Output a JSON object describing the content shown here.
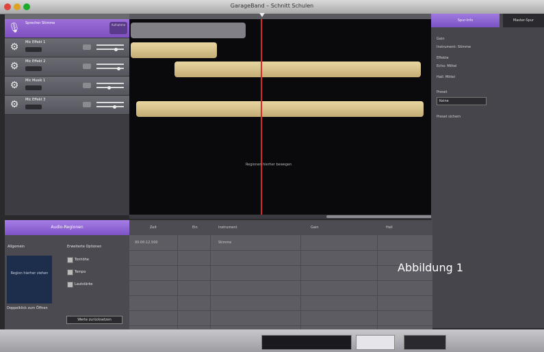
{
  "window": {
    "title": "GarageBand – Schnitt Schulen",
    "traffic_colors": [
      "#e0443e",
      "#dea123",
      "#1aab29"
    ]
  },
  "tracks": [
    {
      "name": "Sprecher Stimme",
      "pill": "Aufnahme",
      "selected": true
    },
    {
      "name": "Mic Effekt 1",
      "pill": ""
    },
    {
      "name": "Mic Effekt 2",
      "pill": ""
    },
    {
      "name": "Mic Musik 1",
      "pill": ""
    },
    {
      "name": "Mic Effekt 3",
      "pill": ""
    }
  ],
  "timeline": {
    "empty_message": "Regionen hierher bewegen"
  },
  "inspector": {
    "tab_active": "Spur-Info",
    "tab_other": "Master-Spur",
    "labels": [
      "Gain",
      "Instrument: Stimme",
      "Effekte",
      "Echo: Mittel",
      "Hall: Mittel"
    ],
    "select_label": "Preset",
    "select_value": "Keine",
    "footer": "Preset sichern"
  },
  "editor": {
    "tab_label": "Audio-Regionen",
    "columns": [
      "Zeit",
      "Ein",
      "Instrument",
      "Gain",
      "Hall"
    ],
    "row1": [
      "00:00:12.500",
      "",
      "Stimme",
      "",
      ""
    ],
    "left": {
      "section": "Allgemein",
      "drop_text": "Region hierher ziehen",
      "hint": "Doppelklick zum Öffnen",
      "options_title": "Erweiterte Optionen",
      "options": [
        "Tonhöhe",
        "Tempo",
        "Lautstärke"
      ],
      "reset_button": "Werte zurücksetzen"
    }
  },
  "annotation": "Abbildung 1"
}
